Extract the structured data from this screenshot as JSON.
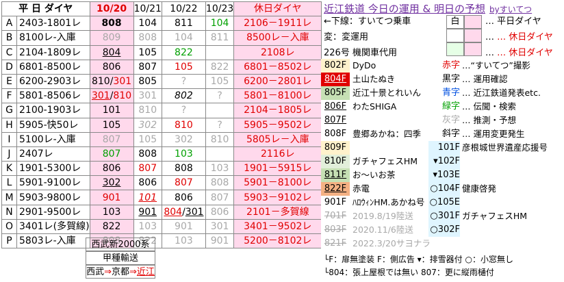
{
  "header": {
    "title": "平 日 ダイヤ",
    "d1": "10/20",
    "d2": "10/21",
    "d3": "10/22",
    "d4": "10/23",
    "holiday": "休日ダイヤ"
  },
  "rows": [
    {
      "id": "A",
      "schedule": "2403-1801レ",
      "v1": "808",
      "v2": "104",
      "v3": "811",
      "v4": "104",
      "holiday": "2106－1911レ"
    },
    {
      "id": "B",
      "schedule": "8100レ-入庫",
      "v1": "809",
      "v2": "808",
      "v3": "104",
      "v4": "811",
      "holiday": "8500レ－入庫"
    },
    {
      "id": "C",
      "schedule": "2104-1809レ",
      "v1": "804",
      "v2": "105",
      "v3": "822",
      "v4": "",
      "holiday": "2108レ"
    },
    {
      "id": "D",
      "schedule": "6801-8500レ",
      "v1": "806",
      "v2": "807",
      "v3": "105",
      "v4": "822",
      "holiday": "6801－8502レ"
    },
    {
      "id": "E",
      "schedule": "6200-2903レ",
      "v1": "810/301",
      "v2": "805",
      "v3": "?",
      "v4": "105",
      "holiday": "6200－2801レ"
    },
    {
      "id": "F",
      "schedule": "5801-8506レ",
      "v1a": "301",
      "v1b": "810",
      "v2": "301",
      "v3": "802",
      "v4": "?",
      "holiday": "5801－8100レ"
    },
    {
      "id": "G",
      "schedule": "2100-1903レ",
      "v1": "101",
      "v2": "810",
      "v3": "?",
      "v4": "",
      "holiday": "2104－1805レ"
    },
    {
      "id": "H",
      "schedule": "5905-快50レ",
      "v1": "105",
      "v2": "302",
      "v3": "810",
      "v4": "?",
      "holiday": "5905－9502レ"
    },
    {
      "id": "I",
      "schedule": "5100レ-入庫",
      "v1": "807",
      "v2": "105",
      "v3": "302",
      "v4": "810",
      "holiday": "5805レ－入庫"
    },
    {
      "id": "J",
      "schedule": "2407レ",
      "v1": "807",
      "v2": "808",
      "v3": "103",
      "v4": "",
      "holiday": "2116レ"
    },
    {
      "id": "K",
      "schedule": "1901-5300レ",
      "v1": "806",
      "v2": "807",
      "v3": "808",
      "v4": "103",
      "holiday": "1901－5915レ"
    },
    {
      "id": "L",
      "schedule": "5901-9100レ",
      "v1": "302",
      "v2": "806",
      "v3": "807",
      "v4": "808",
      "holiday": "5901－8100レ"
    },
    {
      "id": "M",
      "schedule": "5903-9800レ",
      "v1": "901",
      "v2": "101",
      "v3": "806",
      "v4": "807",
      "holiday": "5903－9102レ"
    },
    {
      "id": "N",
      "schedule": "2901-9500レ",
      "v1": "103",
      "v2": "901",
      "v3a": "804",
      "v3b": "301",
      "v4": "806",
      "holiday": "2101－多賀線"
    },
    {
      "id": "O",
      "schedule": "3401レ(多賀線)",
      "v1": "822",
      "v2": "103",
      "v3": "901",
      "v4": "301",
      "holiday": "3401－9502レ"
    },
    {
      "id": "P",
      "schedule": "5803レ-入庫",
      "v1": "808",
      "v2": "822",
      "v3": "103",
      "v4": "901",
      "holiday": "5200－8102レ"
    }
  ],
  "footer": {
    "seibu": "西武新2000系",
    "koshu": "甲種輸送",
    "route_a": "西武",
    "arrow1": "⇒",
    "route_b": "京都",
    "arrow2": "⇒",
    "route_c": "近江"
  },
  "right": {
    "title": "近江鉄道 今日の運用 & 明日の予想",
    "by": "byすいてつ",
    "legend": [
      {
        "text": "←下線：すいてつ乗車",
        "box": "白",
        "desc": "… 平日ダイヤ"
      },
      {
        "text": "変：変運用",
        "desc": "… 休日ダイヤ"
      },
      {
        "text": "226号 機関車代用",
        "desc": "… 休日ダイヤ"
      }
    ],
    "cars": [
      {
        "num": "802F",
        "name": "DyDo",
        "key": "赤字",
        "desc": "…“すいてつ”撮影"
      },
      {
        "num": "804F",
        "name": "土山たぬき",
        "key": "黒字",
        "desc": "… 運用確認"
      },
      {
        "num": "805F",
        "name": "近江十景とれいん",
        "key": "青字",
        "desc": "… 近江鉄道発表etc."
      },
      {
        "num": "806F",
        "name": "わたSHIGA",
        "key": "緑字",
        "desc": "… 伝聞・検索"
      },
      {
        "num": "807F",
        "name": "",
        "key": "灰字",
        "desc": "… 推測・予想"
      },
      {
        "num": "808F",
        "name": "豊郷あかね：四季",
        "key": "斜字",
        "desc": "… 運用変更発生"
      },
      {
        "num": "809F",
        "name": "",
        "key": "101F",
        "desc": "彦根城世界遺産応援号"
      },
      {
        "num": "810F",
        "name": "ガチャフェスHM",
        "key": "▾102F",
        "desc": ""
      },
      {
        "num": "811F",
        "name": "お～いお茶",
        "key": "▾103E",
        "desc": ""
      },
      {
        "num": "822F",
        "name": "赤電",
        "key": "○104F",
        "desc": "健康啓発"
      },
      {
        "num": "901F",
        "name": "ﾊﾛｳｨﾝHM.あかね号",
        "key": "○105E",
        "desc": ""
      },
      {
        "num": "701F",
        "name": "2019.8/19陸送",
        "key": "○301F",
        "desc": "ガチャフェスHM"
      },
      {
        "num": "803F",
        "name": "2020.11/6陸送",
        "key": "○302F",
        "desc": ""
      },
      {
        "num": "821F",
        "name": "2022.3/20サヨナラ",
        "key": "",
        "desc": ""
      }
    ],
    "notes": [
      "└F：扉無塗装  F：側広告 ▾：排雪器付 ○：小窓無し",
      "└804：張上屋根では無い 807：更に縦雨樋付"
    ]
  }
}
